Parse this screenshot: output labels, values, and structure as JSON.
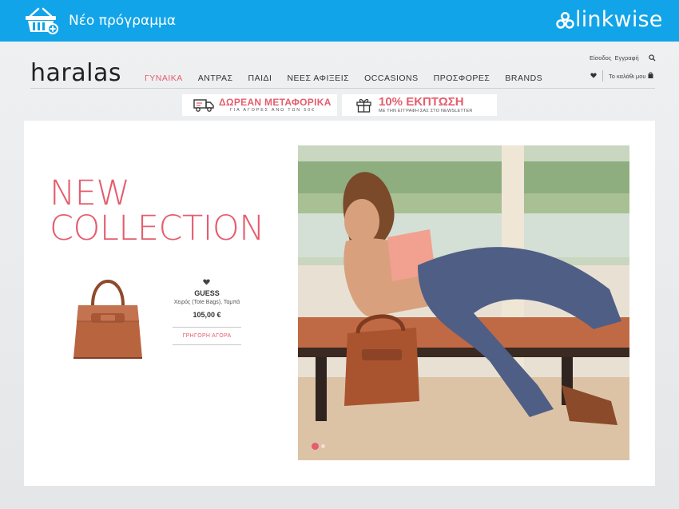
{
  "topbar": {
    "title": "Νέο πρόγραμμα",
    "basket_icon": "shopping-basket-plus-icon",
    "brand": "linkwise",
    "brand_icon": "linkwise-logo-icon",
    "color": "#11a4e8"
  },
  "site": {
    "logo": "haralas",
    "nav": [
      "ΓΥΝΑΙΚΑ",
      "ΑΝΤΡΑΣ",
      "ΠΑΙΔΙ",
      "ΝΕΕΣ ΑΦΙΞΕΙΣ",
      "OCCASIONS",
      "ΠΡΟΣΦΟΡΕΣ",
      "BRANDS"
    ],
    "active_nav": "ΓΥΝΑΙΚΑ",
    "login": "Είσοδος",
    "register": "Εγγραφή",
    "cart": "Το καλάθι μου",
    "accent": "#e55d6e"
  },
  "promos": {
    "shipping_main": "ΔΩΡΕΑΝ ΜΕΤΑΦΟΡΙΚΑ",
    "shipping_sub": "ΓΙΑ ΑΓΟΡΕΣ ΑΝΩ ΤΩΝ 50€",
    "discount_main": "10% ΕΚΠΤΩΣΗ",
    "discount_sub": "ΜΕ ΤΗΝ ΕΓΓΡΑΦΗ ΣΑΣ ΣΤΟ NEWSLETTER"
  },
  "hero": {
    "headline_line1": "NEW",
    "headline_line2": "COLLECTION"
  },
  "product": {
    "brand": "GUESS",
    "category": "Χειρός (Tote Bags), Ταμπά",
    "price": "105,00 €",
    "quick_buy": "ΓΡΗΓΟΡΗ ΑΓΟΡΑ"
  }
}
